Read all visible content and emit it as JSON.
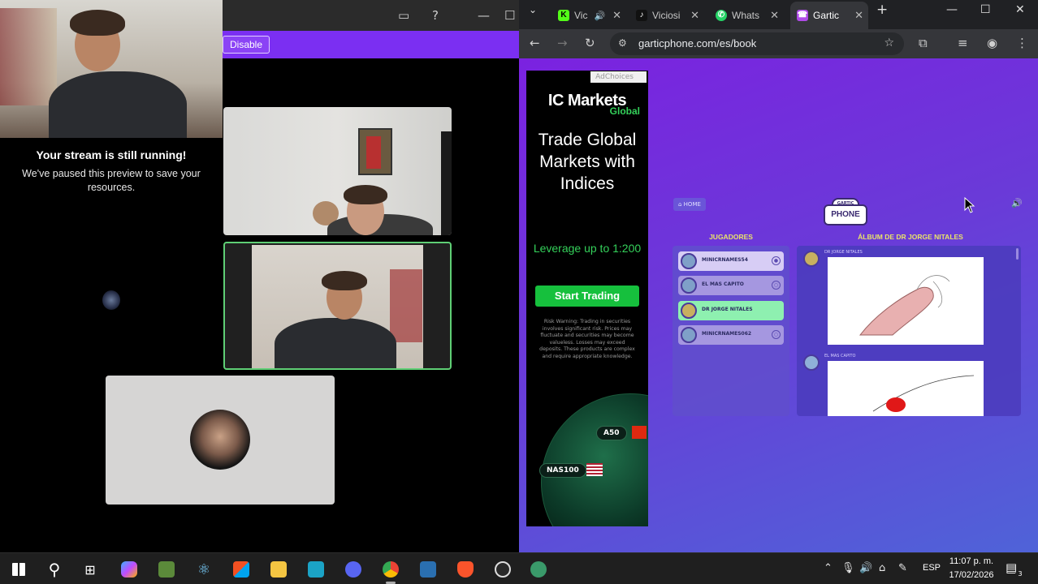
{
  "left_window": {
    "disable_label": "Disable",
    "paused_title": "Your stream is still running!",
    "paused_message": "We've paused this preview to save your resources."
  },
  "browser": {
    "tabs": [
      {
        "label": "Vic",
        "icon": "kick-icon",
        "color": "#53fc18"
      },
      {
        "label": "Viciosi",
        "icon": "tiktok-icon",
        "color": "#111111"
      },
      {
        "label": "Whats",
        "icon": "whatsapp-icon",
        "color": "#25d366"
      },
      {
        "label": "Gartic",
        "icon": "gartic-phone-icon",
        "color": "#b04be8"
      }
    ],
    "new_tab_label": "+",
    "url": "garticphone.com/es/book"
  },
  "ad": {
    "adchoices": "AdChoices",
    "logo": "IC Markets",
    "logo_sub": "Global",
    "headline": "Trade Global Markets with Indices",
    "leverage": "Leverage up to 1:200",
    "cta": "Start Trading",
    "risk": "Risk Warning: Trading in securities involves significant risk. Prices may fluctuate and securities may become valueless. Losses may exceed deposits. These products are complex and require appropriate knowledge.",
    "chip_1": "A50",
    "chip_2": "NAS100",
    "badge": "A"
  },
  "gartic": {
    "home": "HOME",
    "logo_cap": "GARTIC",
    "logo_phone": "PHONE",
    "players_heading": "JUGADORES",
    "album_heading": "ÁLBUM DE DR JORGE NITALES",
    "players": [
      {
        "name": "MINICRNAMES54"
      },
      {
        "name": "EL MAS CAPITO"
      },
      {
        "name": "DR JORGE NITALES"
      },
      {
        "name": "MINICRNAMES062"
      }
    ],
    "entries": [
      {
        "name": "DR JORGE NITALES"
      },
      {
        "name": "EL MAS CAPITO"
      }
    ]
  },
  "taskbar": {
    "language": "ESP",
    "time": "11:07 p. m.",
    "date": "17/02/2026",
    "notification_count": "3"
  }
}
